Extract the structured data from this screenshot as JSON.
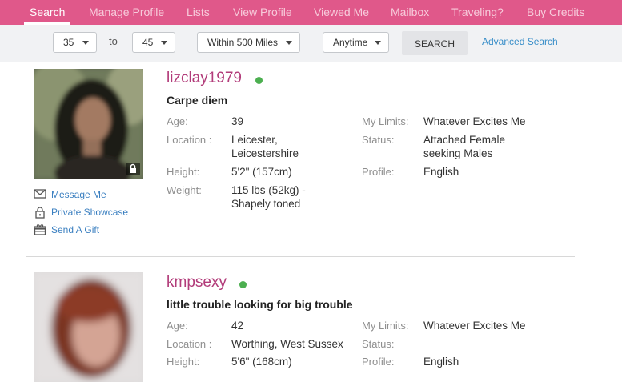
{
  "nav": {
    "tabs": [
      {
        "label": "Search",
        "active": true
      },
      {
        "label": "Manage Profile"
      },
      {
        "label": "Lists"
      },
      {
        "label": "View Profile"
      },
      {
        "label": "Viewed Me"
      },
      {
        "label": "Mailbox"
      },
      {
        "label": "Traveling?"
      },
      {
        "label": "Buy Credits"
      }
    ]
  },
  "filters": {
    "age_min": "35",
    "to_label": "to",
    "age_max": "45",
    "distance": "Within 500 Miles",
    "time": "Anytime",
    "search_label": "SEARCH",
    "advanced_label": "Advanced Search"
  },
  "profiles": [
    {
      "username": "lizclay1979",
      "tagline": "Carpe diem",
      "labels": {
        "age": "Age:",
        "location": "Location :",
        "height": "Height:",
        "weight": "Weight:",
        "limits": "My Limits:",
        "status": "Status:",
        "profile": "Profile:"
      },
      "age": "39",
      "location_line1": "Leicester,",
      "location_line2": "Leicestershire",
      "height": "5'2\" (157cm)",
      "weight_line1": "115 lbs (52kg) -",
      "weight_line2": "Shapely toned",
      "limits": "Whatever Excites Me",
      "status_line1": "Attached Female",
      "status_line2": "seeking Males",
      "profile": "English",
      "actions": {
        "message": "Message Me",
        "showcase": "Private Showcase",
        "gift": "Send A Gift"
      }
    },
    {
      "username": "kmpsexy",
      "tagline": "little trouble looking for big trouble",
      "labels": {
        "age": "Age:",
        "location": "Location :",
        "height": "Height:",
        "limits": "My Limits:",
        "status": "Status:",
        "profile": "Profile:"
      },
      "age": "42",
      "location": "Worthing, West Sussex",
      "height": "5'6\" (168cm)",
      "limits": "Whatever Excites Me",
      "status": "",
      "profile": "English"
    }
  ],
  "colors": {
    "nav_bg": "#e0588a",
    "username": "#b23c7a",
    "link": "#3a7fc0",
    "online": "#4caf50"
  },
  "icons": [
    "envelope-icon",
    "lock-icon",
    "gift-icon",
    "caret-down-icon",
    "online-dot"
  ]
}
